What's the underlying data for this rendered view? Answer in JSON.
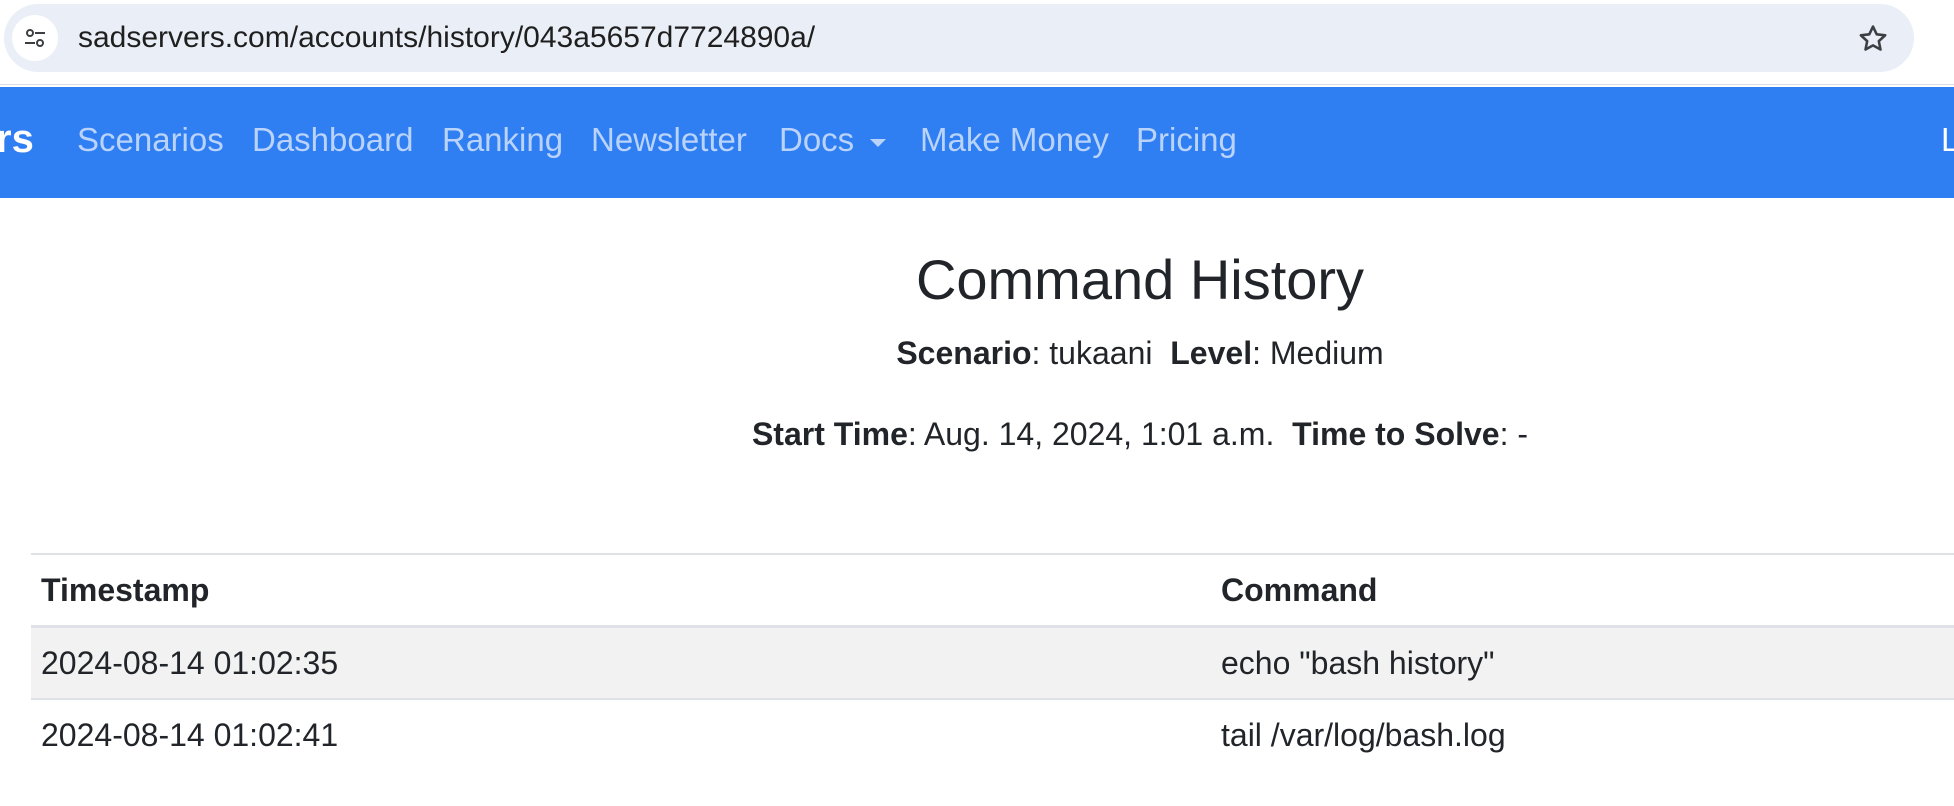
{
  "browser": {
    "url": "sadservers.com/accounts/history/043a5657d7724890a/"
  },
  "navbar": {
    "brand": "rs",
    "items": [
      "Scenarios",
      "Dashboard",
      "Ranking",
      "Newsletter",
      "Docs",
      "Make Money",
      "Pricing"
    ],
    "right_item": "L",
    "color": "#2f7ef2"
  },
  "page": {
    "title": "Command History",
    "scenario_label": "Scenario",
    "scenario_value": "tukaani",
    "level_label": "Level",
    "level_value": "Medium",
    "start_time_label": "Start Time",
    "start_time_value": "Aug. 14, 2024, 1:01 a.m.",
    "time_to_solve_label": "Time to Solve",
    "time_to_solve_value": "-"
  },
  "table": {
    "headers": [
      "Timestamp",
      "Command"
    ],
    "rows": [
      [
        "2024-08-14 01:02:35",
        "echo \"bash history\""
      ],
      [
        "2024-08-14 01:02:41",
        "tail /var/log/bash.log"
      ]
    ]
  }
}
